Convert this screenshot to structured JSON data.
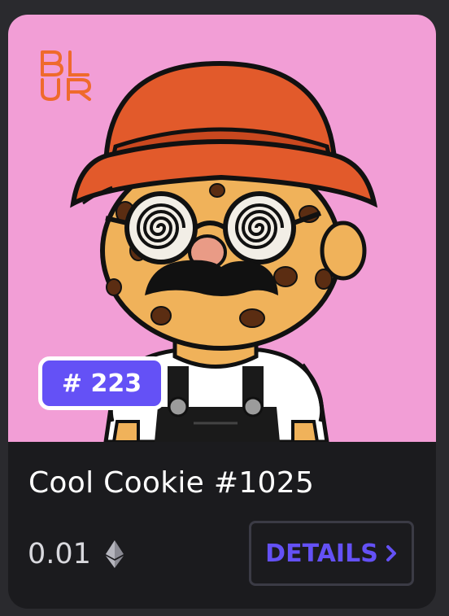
{
  "logo_text": "BLUR",
  "rank_badge": "# 223",
  "nft": {
    "title": "Cool Cookie #1025",
    "price": "0.01",
    "currency_icon": "ethereum-icon"
  },
  "details_button": {
    "label": "DETAILS",
    "icon": "chevron-right-icon"
  },
  "colors": {
    "accent": "#6451f6",
    "art_background": "#f29ed6",
    "card_background": "#1b1b1e",
    "hat": "#e25a2b",
    "logo": "#ef6a2c"
  }
}
